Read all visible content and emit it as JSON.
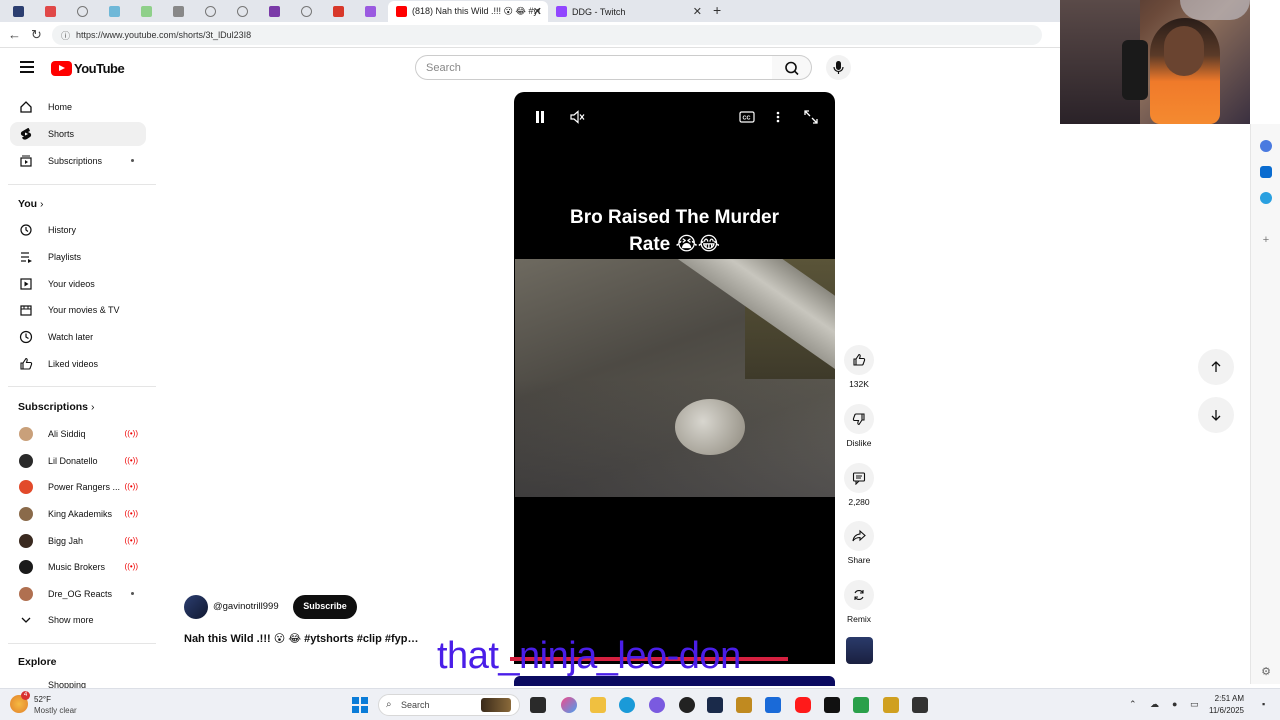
{
  "browser": {
    "tabs": [
      {
        "title": "(818) Nah this Wild .!!! 😮 😂 #yt",
        "active": true
      },
      {
        "title": "DDG - Twitch",
        "active": false
      }
    ],
    "url": "https://www.youtube.com/shorts/3t_lDul23I8"
  },
  "header": {
    "logo_text": "YouTube",
    "search_placeholder": "Search"
  },
  "sidebar": {
    "main": [
      {
        "label": "Home",
        "icon": "home-icon"
      },
      {
        "label": "Shorts",
        "icon": "shorts-icon",
        "active": true
      },
      {
        "label": "Subscriptions",
        "icon": "subscriptions-icon"
      }
    ],
    "you_heading": "You",
    "you_items": [
      {
        "label": "History",
        "icon": "history-icon"
      },
      {
        "label": "Playlists",
        "icon": "playlists-icon"
      },
      {
        "label": "Your videos",
        "icon": "your-videos-icon"
      },
      {
        "label": "Your movies & TV",
        "icon": "movies-icon"
      },
      {
        "label": "Watch later",
        "icon": "watch-later-icon"
      },
      {
        "label": "Liked videos",
        "icon": "liked-icon"
      }
    ],
    "subscriptions_heading": "Subscriptions",
    "subscriptions": [
      {
        "name": "Ali Siddiq",
        "live": true,
        "color": "#c9a07a"
      },
      {
        "name": "Lil Donatello",
        "live": true,
        "color": "#2a2a2a"
      },
      {
        "name": "Power Rangers ...",
        "live": true,
        "color": "#e24a2a"
      },
      {
        "name": "King Akademiks",
        "live": true,
        "color": "#8a6a4a"
      },
      {
        "name": "Bigg Jah",
        "live": true,
        "color": "#3a2a20"
      },
      {
        "name": "Music Brokers",
        "live": true,
        "color": "#1a1a1a"
      },
      {
        "name": "Dre_OG Reacts",
        "live": false,
        "color": "#b07050"
      }
    ],
    "show_more": "Show more",
    "explore_heading": "Explore",
    "explore_first": "Shopping"
  },
  "video": {
    "title_line1": "Bro Raised The Murder",
    "title_line2": "Rate 😭😂"
  },
  "actions": {
    "likes": "132K",
    "dislike": "Dislike",
    "comments": "2,280",
    "share": "Share",
    "remix": "Remix"
  },
  "channel": {
    "handle": "@gavinotrill999",
    "subscribe": "Subscribe",
    "description": "Nah this Wild .!!! 😮 😂 #ytshorts #clip #fyp…"
  },
  "overlay": {
    "text": "that_ninja_leo-don"
  },
  "taskbar": {
    "weather_badge": "4",
    "temp": "52°F",
    "weather": "Mostly clear",
    "search": "Search",
    "time": "2:51 AM",
    "date": "11/6/2025"
  },
  "colors": {
    "youtube_red": "#ff0000",
    "overlay_text": "#4a1ee8",
    "live_red": "#e00000"
  }
}
